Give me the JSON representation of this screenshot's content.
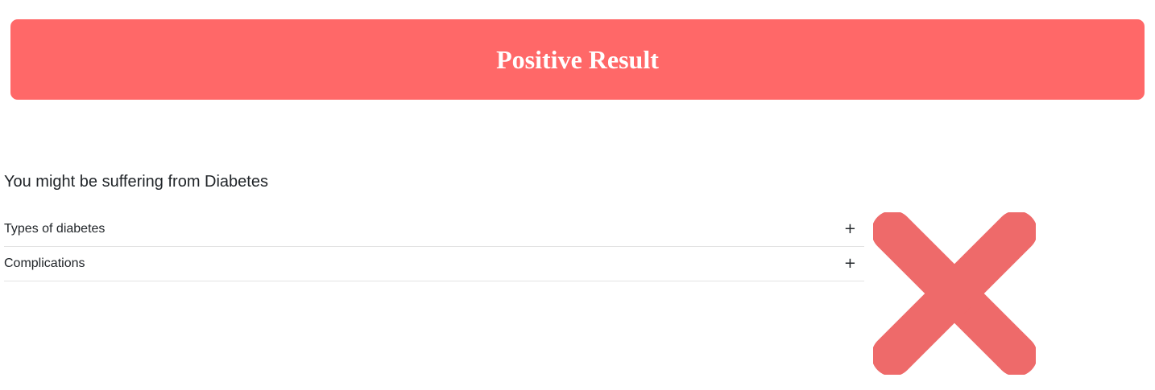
{
  "banner": {
    "title": "Positive Result",
    "color": "#ff6868"
  },
  "result": {
    "message": "You might be suffering from Diabetes",
    "icon": "cross-icon",
    "icon_color": "#ee6a6a"
  },
  "accordion": {
    "items": [
      {
        "label": "Types of diabetes",
        "toggle": "+"
      },
      {
        "label": "Complications",
        "toggle": "+"
      }
    ]
  }
}
